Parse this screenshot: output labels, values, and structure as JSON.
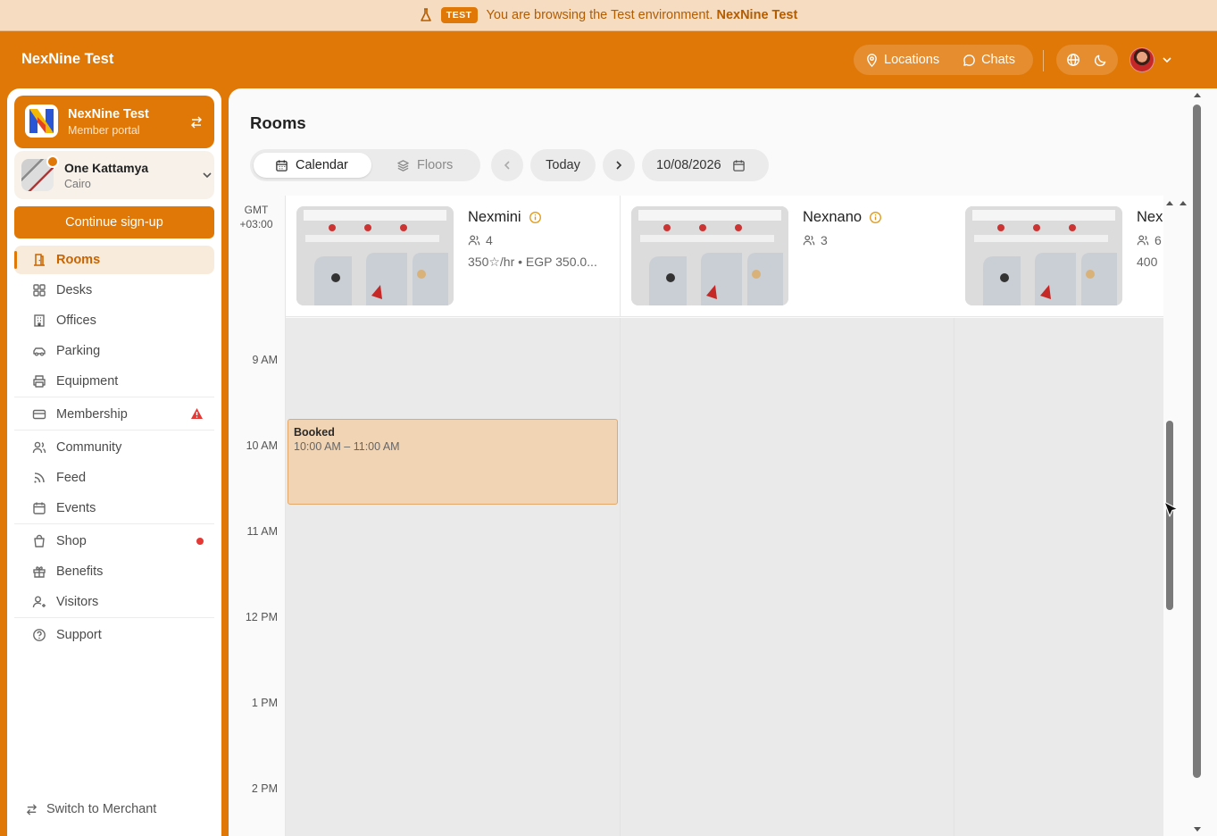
{
  "banner": {
    "badge": "TEST",
    "message": "You are browsing the Test environment.",
    "env_name": "NexNine Test"
  },
  "topbar": {
    "brand": "NexNine Test",
    "locations_label": "Locations",
    "chats_label": "Chats"
  },
  "sidebar": {
    "org": {
      "name": "NexNine Test",
      "subtitle": "Member portal"
    },
    "location": {
      "name": "One Kattamya",
      "city": "Cairo"
    },
    "signup_label": "Continue sign-up",
    "items": [
      {
        "label": "Rooms",
        "icon": "rooms-icon",
        "active": true
      },
      {
        "label": "Desks",
        "icon": "desks-icon"
      },
      {
        "label": "Offices",
        "icon": "offices-icon"
      },
      {
        "label": "Parking",
        "icon": "car-icon"
      },
      {
        "label": "Equipment",
        "icon": "printer-icon"
      },
      {
        "label": "Membership",
        "icon": "card-icon",
        "alert": "warning-icon"
      },
      {
        "label": "Community",
        "icon": "users-icon"
      },
      {
        "label": "Feed",
        "icon": "rss-icon"
      },
      {
        "label": "Events",
        "icon": "calendar-icon"
      },
      {
        "label": "Shop",
        "icon": "shopping-bag-icon",
        "dot": true
      },
      {
        "label": "Benefits",
        "icon": "gift-icon"
      },
      {
        "label": "Visitors",
        "icon": "visitors-icon"
      },
      {
        "label": "Support",
        "icon": "help-circle-icon"
      }
    ],
    "switch_label": "Switch to Merchant"
  },
  "main": {
    "title": "Rooms",
    "view_tabs": [
      {
        "label": "Calendar",
        "active": true
      },
      {
        "label": "Floors",
        "active": false
      }
    ],
    "today_label": "Today",
    "date": "10/08/2026",
    "timezone": {
      "line1": "GMT",
      "line2": "+03:00"
    },
    "rooms": [
      {
        "name": "Nexmini",
        "capacity": "4",
        "price": "350☆/hr • EGP 350.0..."
      },
      {
        "name": "Nexnano",
        "capacity": "3",
        "price": ""
      },
      {
        "name": "Nex",
        "capacity": "6",
        "price": "400"
      }
    ],
    "hours": [
      "9 AM",
      "10 AM",
      "11 AM",
      "12 PM",
      "1 PM",
      "2 PM"
    ],
    "booking": {
      "title": "Booked",
      "time": "10:00 AM – 11:00 AM"
    }
  },
  "colors": {
    "brand_orange": "#e07808",
    "banner_bg": "#f6dcc0",
    "booking_bg": "#f1d4b4",
    "alert_red": "#e53935"
  }
}
